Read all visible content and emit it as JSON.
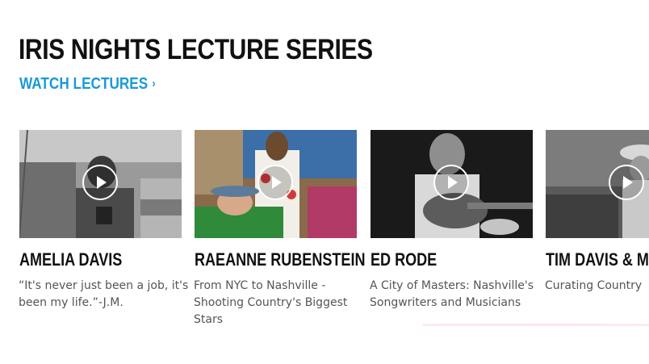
{
  "section": {
    "title": "IRIS NIGHTS LECTURE SERIES",
    "watch_link": "WATCH LECTURES",
    "watch_link_icon": "chevron-right-icon"
  },
  "colors": {
    "accent": "#1a9ad6",
    "title": "#111111",
    "description": "#555555"
  },
  "lectures": [
    {
      "name": "AMELIA DAVIS",
      "description": "“It's never just been a job, it's been my life.”-J.M.",
      "thumbnail_tone": "black-and-white",
      "play_icon": "play-icon"
    },
    {
      "name": "RAEANNE RUBENSTEIN",
      "description": "From NYC to Nashville - Shooting Country's Biggest Stars",
      "thumbnail_tone": "color",
      "play_icon": "play-icon"
    },
    {
      "name": "ED RODE",
      "description": "A City of Masters: Nashville's Songwriters and Musicians",
      "thumbnail_tone": "black-and-white",
      "play_icon": "play-icon"
    },
    {
      "name": "TIM DAVIS & MIC",
      "description": "Curating Country",
      "thumbnail_tone": "black-and-white",
      "play_icon": "play-icon"
    }
  ]
}
